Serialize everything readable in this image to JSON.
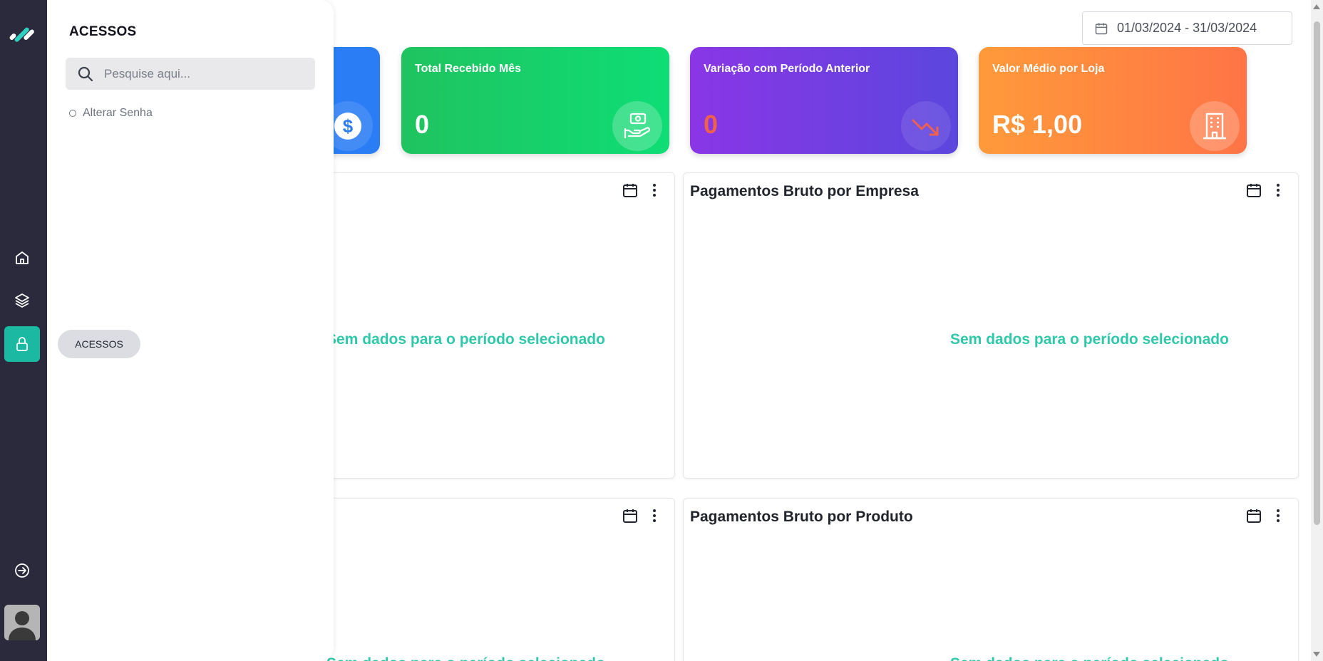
{
  "panel": {
    "title": "ACESSOS",
    "search_placeholder": "Pesquise aqui...",
    "items": [
      {
        "label": "Alterar Senha"
      }
    ],
    "tooltip": "ACESSOS"
  },
  "rail": {
    "icons": [
      "logo-icon",
      "home-icon",
      "layers-icon",
      "lock-icon",
      "logout-icon",
      "avatar"
    ],
    "active": "lock-icon",
    "accent": "#1bb8a2"
  },
  "date_range": "01/03/2024 - 31/03/2024",
  "kpis": [
    {
      "label": "",
      "value": "",
      "icon": "dollar-icon",
      "color": "#2a7df5"
    },
    {
      "label": "Total Recebido Mês",
      "value": "0",
      "icon": "money-hand-icon",
      "color": "#15cf6a"
    },
    {
      "label": "Variação com Período Anterior",
      "value": "0",
      "value_color": "#f0604a",
      "icon": "trend-down-icon",
      "color": "#7b3fe4"
    },
    {
      "label": "Valor Médio por Loja",
      "value": "R$ 1,00",
      "icon": "building-icon",
      "color": "#ff8a3d"
    }
  ],
  "cards": [
    {
      "title": "",
      "empty_text": "Sem dados para o período selecionado"
    },
    {
      "title": "Pagamentos Bruto por Empresa",
      "empty_text": "Sem dados para o período selecionado"
    },
    {
      "title": "",
      "empty_text": "Sem dados para o período selecionado"
    },
    {
      "title": "Pagamentos Bruto por Produto",
      "empty_text": "Sem dados para o período selecionado"
    }
  ]
}
